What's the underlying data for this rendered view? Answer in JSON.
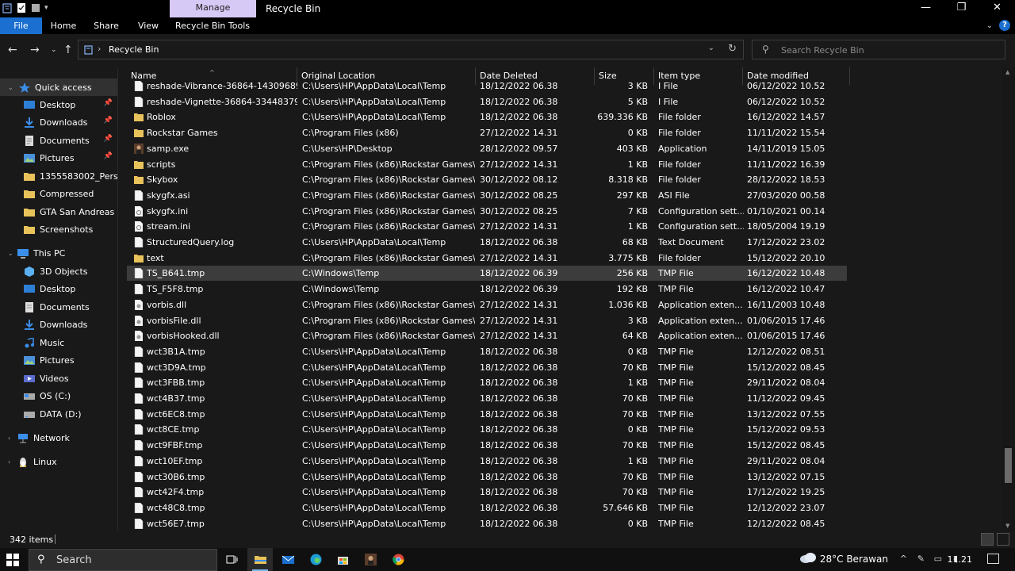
{
  "window": {
    "title": "Recycle Bin",
    "manage_tab": "Manage",
    "minimize": "—",
    "maximize": "❐",
    "close": "✕"
  },
  "ribbon": {
    "tabs": [
      "File",
      "Home",
      "Share",
      "View",
      "Recycle Bin Tools"
    ]
  },
  "address": {
    "crumb": "Recycle Bin"
  },
  "search": {
    "placeholder": "Search Recycle Bin"
  },
  "nav": {
    "items": [
      {
        "label": "Quick access",
        "icon": "star-icon",
        "pinned": false
      },
      {
        "label": "Desktop",
        "icon": "desktop-folder-icon",
        "pinned": true
      },
      {
        "label": "Downloads",
        "icon": "download-icon",
        "pinned": true
      },
      {
        "label": "Documents",
        "icon": "documents-icon",
        "pinned": true
      },
      {
        "label": "Pictures",
        "icon": "pictures-icon",
        "pinned": true
      },
      {
        "label": "1355583002_Persona",
        "icon": "folder-icon",
        "pinned": false
      },
      {
        "label": "Compressed",
        "icon": "folder-icon",
        "pinned": false
      },
      {
        "label": "GTA San Andreas",
        "icon": "folder-icon",
        "pinned": false
      },
      {
        "label": "Screenshots",
        "icon": "folder-icon",
        "pinned": false
      },
      {
        "label": "This PC",
        "icon": "computer-icon",
        "pinned": false
      },
      {
        "label": "3D Objects",
        "icon": "3d-objects-icon",
        "pinned": false
      },
      {
        "label": "Desktop",
        "icon": "desktop-folder-icon",
        "pinned": false
      },
      {
        "label": "Documents",
        "icon": "documents-icon",
        "pinned": false
      },
      {
        "label": "Downloads",
        "icon": "download-icon",
        "pinned": false
      },
      {
        "label": "Music",
        "icon": "music-icon",
        "pinned": false
      },
      {
        "label": "Pictures",
        "icon": "pictures-icon",
        "pinned": false
      },
      {
        "label": "Videos",
        "icon": "videos-icon",
        "pinned": false
      },
      {
        "label": "OS (C:)",
        "icon": "drive-icon",
        "pinned": false
      },
      {
        "label": "DATA (D:)",
        "icon": "drive-icon",
        "pinned": false
      },
      {
        "label": "Network",
        "icon": "network-icon",
        "pinned": false
      },
      {
        "label": "Linux",
        "icon": "linux-icon",
        "pinned": false
      }
    ]
  },
  "columns": [
    "Name",
    "Original Location",
    "Date Deleted",
    "Size",
    "Item type",
    "Date modified"
  ],
  "files": [
    {
      "name": "reshade-Vibrance-36864-14309689...",
      "loc": "C:\\Users\\HP\\AppData\\Local\\Temp",
      "deleted": "18/12/2022 06.38",
      "size": "3 KB",
      "type": "I File",
      "modified": "06/12/2022 10.52",
      "icon": "file"
    },
    {
      "name": "reshade-Vignette-36864-334483799...",
      "loc": "C:\\Users\\HP\\AppData\\Local\\Temp",
      "deleted": "18/12/2022 06.38",
      "size": "5 KB",
      "type": "I File",
      "modified": "06/12/2022 10.52",
      "icon": "file"
    },
    {
      "name": "Roblox",
      "loc": "C:\\Users\\HP\\AppData\\Local\\Temp",
      "deleted": "18/12/2022 06.38",
      "size": "639.336 KB",
      "type": "File folder",
      "modified": "16/12/2022 14.57",
      "icon": "folder"
    },
    {
      "name": "Rockstar Games",
      "loc": "C:\\Program Files (x86)",
      "deleted": "27/12/2022 14.31",
      "size": "0 KB",
      "type": "File folder",
      "modified": "11/11/2022 15.54",
      "icon": "folder"
    },
    {
      "name": "samp.exe",
      "loc": "C:\\Users\\HP\\Desktop",
      "deleted": "28/12/2022 09.57",
      "size": "403 KB",
      "type": "Application",
      "modified": "14/11/2019 15.05",
      "icon": "exe"
    },
    {
      "name": "scripts",
      "loc": "C:\\Program Files (x86)\\Rockstar Games\\...",
      "deleted": "27/12/2022 14.31",
      "size": "1 KB",
      "type": "File folder",
      "modified": "11/11/2022 16.39",
      "icon": "folder"
    },
    {
      "name": "Skybox",
      "loc": "C:\\Program Files (x86)\\Rockstar Games\\...",
      "deleted": "30/12/2022 08.12",
      "size": "8.318 KB",
      "type": "File folder",
      "modified": "28/12/2022 18.53",
      "icon": "folder"
    },
    {
      "name": "skygfx.asi",
      "loc": "C:\\Program Files (x86)\\Rockstar Games\\...",
      "deleted": "30/12/2022 08.25",
      "size": "297 KB",
      "type": "ASI File",
      "modified": "27/03/2020 00.58",
      "icon": "file"
    },
    {
      "name": "skygfx.ini",
      "loc": "C:\\Program Files (x86)\\Rockstar Games\\...",
      "deleted": "30/12/2022 08.25",
      "size": "7 KB",
      "type": "Configuration sett...",
      "modified": "01/10/2021 00.14",
      "icon": "ini"
    },
    {
      "name": "stream.ini",
      "loc": "C:\\Program Files (x86)\\Rockstar Games\\...",
      "deleted": "27/12/2022 14.31",
      "size": "1 KB",
      "type": "Configuration sett...",
      "modified": "18/05/2004 19.19",
      "icon": "ini"
    },
    {
      "name": "StructuredQuery.log",
      "loc": "C:\\Users\\HP\\AppData\\Local\\Temp",
      "deleted": "18/12/2022 06.38",
      "size": "68 KB",
      "type": "Text Document",
      "modified": "17/12/2022 23.02",
      "icon": "file"
    },
    {
      "name": "text",
      "loc": "C:\\Program Files (x86)\\Rockstar Games\\...",
      "deleted": "27/12/2022 14.31",
      "size": "3.775 KB",
      "type": "File folder",
      "modified": "15/12/2022 20.10",
      "icon": "folder"
    },
    {
      "name": "TS_B641.tmp",
      "loc": "C:\\Windows\\Temp",
      "deleted": "18/12/2022 06.39",
      "size": "256 KB",
      "type": "TMP File",
      "modified": "16/12/2022 10.48",
      "icon": "file",
      "selected": true
    },
    {
      "name": "TS_F5F8.tmp",
      "loc": "C:\\Windows\\Temp",
      "deleted": "18/12/2022 06.39",
      "size": "192 KB",
      "type": "TMP File",
      "modified": "16/12/2022 10.47",
      "icon": "file"
    },
    {
      "name": "vorbis.dll",
      "loc": "C:\\Program Files (x86)\\Rockstar Games\\...",
      "deleted": "27/12/2022 14.31",
      "size": "1.036 KB",
      "type": "Application exten...",
      "modified": "16/11/2003 10.48",
      "icon": "dll"
    },
    {
      "name": "vorbisFile.dll",
      "loc": "C:\\Program Files (x86)\\Rockstar Games\\...",
      "deleted": "27/12/2022 14.31",
      "size": "3 KB",
      "type": "Application exten...",
      "modified": "01/06/2015 17.46",
      "icon": "dll"
    },
    {
      "name": "vorbisHooked.dll",
      "loc": "C:\\Program Files (x86)\\Rockstar Games\\...",
      "deleted": "27/12/2022 14.31",
      "size": "64 KB",
      "type": "Application exten...",
      "modified": "01/06/2015 17.46",
      "icon": "dll"
    },
    {
      "name": "wct3B1A.tmp",
      "loc": "C:\\Users\\HP\\AppData\\Local\\Temp",
      "deleted": "18/12/2022 06.38",
      "size": "0 KB",
      "type": "TMP File",
      "modified": "12/12/2022 08.51",
      "icon": "file"
    },
    {
      "name": "wct3D9A.tmp",
      "loc": "C:\\Users\\HP\\AppData\\Local\\Temp",
      "deleted": "18/12/2022 06.38",
      "size": "70 KB",
      "type": "TMP File",
      "modified": "15/12/2022 08.45",
      "icon": "file"
    },
    {
      "name": "wct3FBB.tmp",
      "loc": "C:\\Users\\HP\\AppData\\Local\\Temp",
      "deleted": "18/12/2022 06.38",
      "size": "1 KB",
      "type": "TMP File",
      "modified": "29/11/2022 08.04",
      "icon": "file"
    },
    {
      "name": "wct4B37.tmp",
      "loc": "C:\\Users\\HP\\AppData\\Local\\Temp",
      "deleted": "18/12/2022 06.38",
      "size": "70 KB",
      "type": "TMP File",
      "modified": "11/12/2022 09.45",
      "icon": "file"
    },
    {
      "name": "wct6EC8.tmp",
      "loc": "C:\\Users\\HP\\AppData\\Local\\Temp",
      "deleted": "18/12/2022 06.38",
      "size": "70 KB",
      "type": "TMP File",
      "modified": "13/12/2022 07.55",
      "icon": "file"
    },
    {
      "name": "wct8CE.tmp",
      "loc": "C:\\Users\\HP\\AppData\\Local\\Temp",
      "deleted": "18/12/2022 06.38",
      "size": "0 KB",
      "type": "TMP File",
      "modified": "15/12/2022 09.53",
      "icon": "file"
    },
    {
      "name": "wct9FBF.tmp",
      "loc": "C:\\Users\\HP\\AppData\\Local\\Temp",
      "deleted": "18/12/2022 06.38",
      "size": "70 KB",
      "type": "TMP File",
      "modified": "15/12/2022 08.45",
      "icon": "file"
    },
    {
      "name": "wct10EF.tmp",
      "loc": "C:\\Users\\HP\\AppData\\Local\\Temp",
      "deleted": "18/12/2022 06.38",
      "size": "1 KB",
      "type": "TMP File",
      "modified": "29/11/2022 08.04",
      "icon": "file"
    },
    {
      "name": "wct30B6.tmp",
      "loc": "C:\\Users\\HP\\AppData\\Local\\Temp",
      "deleted": "18/12/2022 06.38",
      "size": "70 KB",
      "type": "TMP File",
      "modified": "13/12/2022 07.15",
      "icon": "file"
    },
    {
      "name": "wct42F4.tmp",
      "loc": "C:\\Users\\HP\\AppData\\Local\\Temp",
      "deleted": "18/12/2022 06.38",
      "size": "70 KB",
      "type": "TMP File",
      "modified": "17/12/2022 19.25",
      "icon": "file"
    },
    {
      "name": "wct48C8.tmp",
      "loc": "C:\\Users\\HP\\AppData\\Local\\Temp",
      "deleted": "18/12/2022 06.38",
      "size": "57.646 KB",
      "type": "TMP File",
      "modified": "12/12/2022 23.07",
      "icon": "file"
    },
    {
      "name": "wct56E7.tmp",
      "loc": "C:\\Users\\HP\\AppData\\Local\\Temp",
      "deleted": "18/12/2022 06.38",
      "size": "0 KB",
      "type": "TMP File",
      "modified": "12/12/2022 08.45",
      "icon": "file"
    }
  ],
  "status": {
    "count": "342 items"
  },
  "taskbar": {
    "search_label": "Search",
    "weather": "28°C  Berawan",
    "time": "11.21",
    "apps": [
      "task-view-icon",
      "file-explorer-icon",
      "mail-icon",
      "edge-icon",
      "store-icon",
      "samp-icon",
      "chrome-icon"
    ]
  },
  "colors": {
    "accent": "#1a6fd0",
    "manage_tab": "#d7c9f5",
    "folder": "#e8c25a",
    "selected_row": "#3c3c3c",
    "background": "#191919"
  }
}
